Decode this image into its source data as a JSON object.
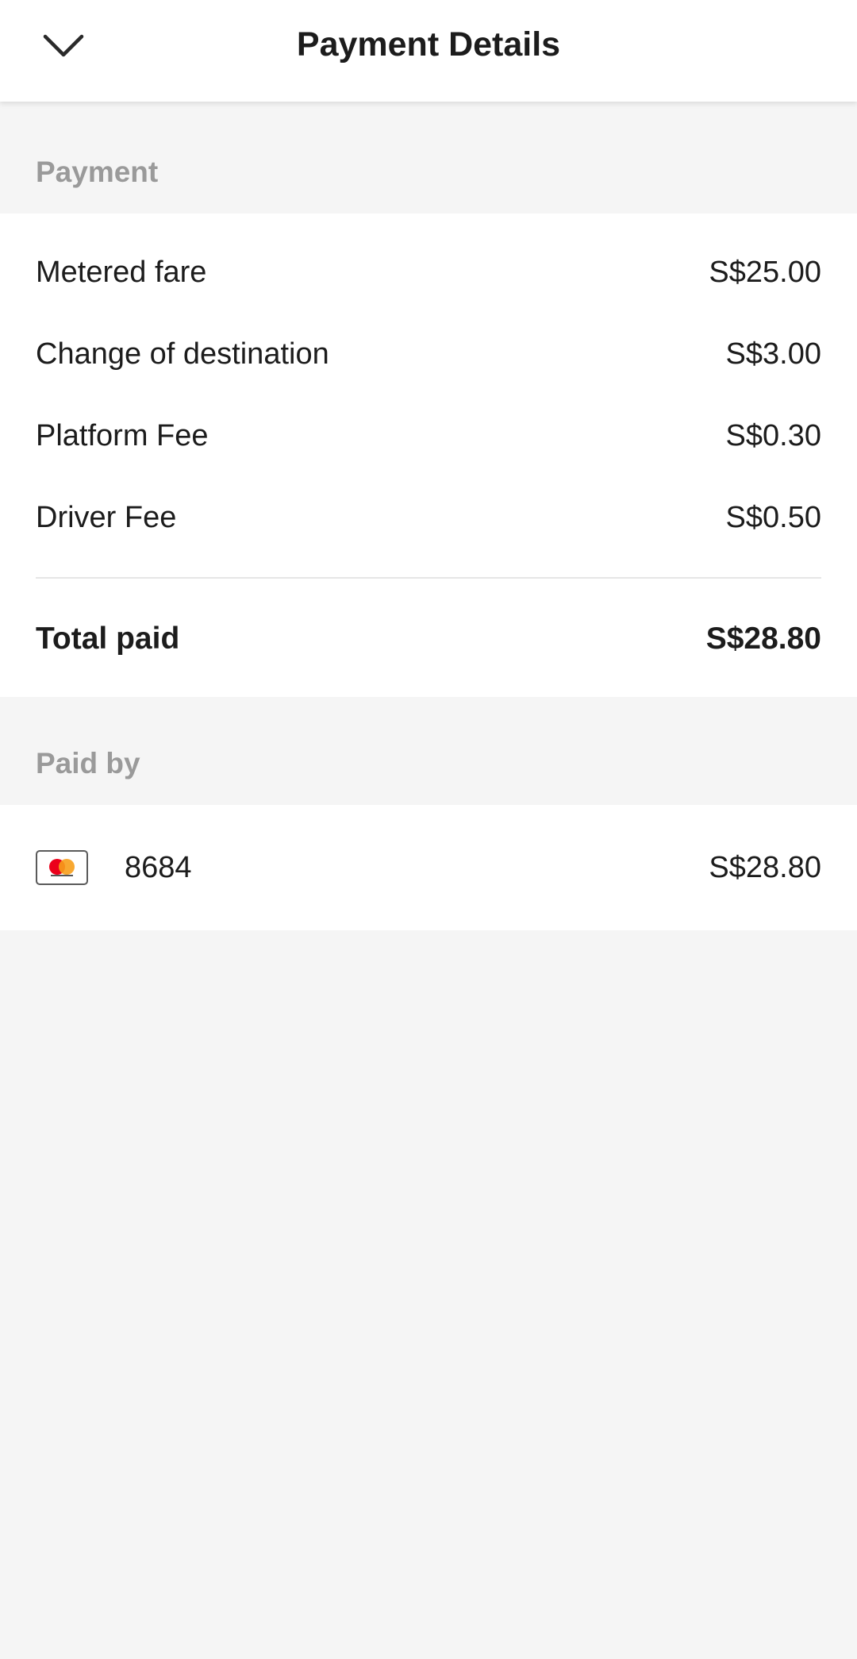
{
  "header": {
    "title": "Payment Details",
    "back_icon": "chevron-down-icon"
  },
  "payment": {
    "section_label": "Payment",
    "items": [
      {
        "label": "Metered fare",
        "amount": "S$25.00"
      },
      {
        "label": "Change of destination",
        "amount": "S$3.00"
      },
      {
        "label": "Platform Fee",
        "amount": "S$0.30"
      },
      {
        "label": "Driver Fee",
        "amount": "S$0.50"
      }
    ],
    "total_label": "Total paid",
    "total_amount": "S$28.80"
  },
  "paid_by": {
    "section_label": "Paid by",
    "card_icon": "mastercard-icon",
    "card_number": "8684",
    "amount": "S$28.80"
  },
  "colors": {
    "background": "#f5f5f5",
    "card": "#ffffff",
    "label_gray": "#9a9a9a",
    "text": "#1c1c1c",
    "mastercard_red": "#eb001b",
    "mastercard_orange": "#f79e1b"
  }
}
